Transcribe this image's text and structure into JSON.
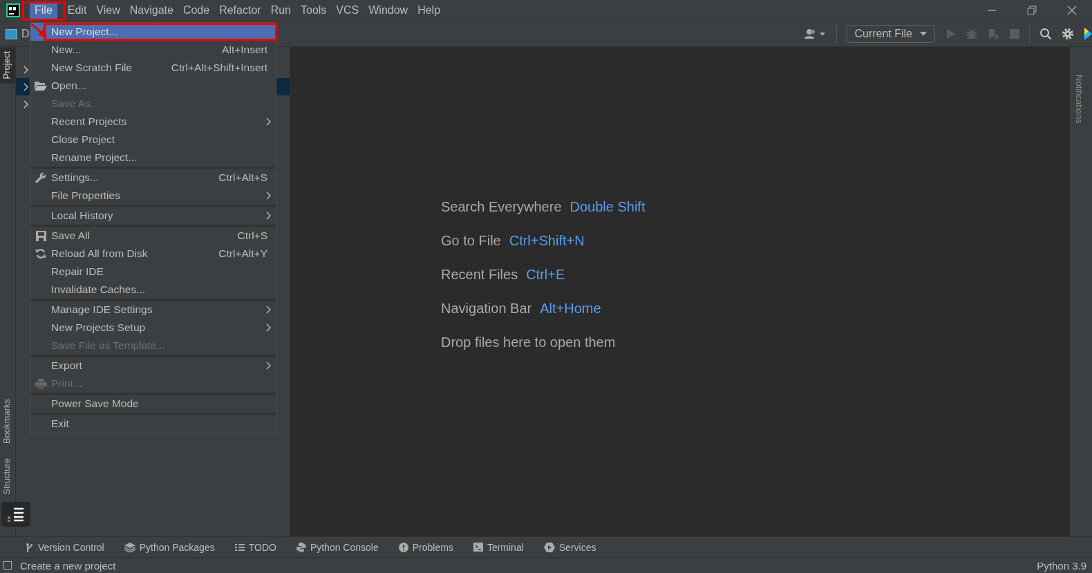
{
  "menubar": [
    {
      "label": "File",
      "selected": true
    },
    {
      "label": "Edit",
      "selected": false
    },
    {
      "label": "View",
      "selected": false
    },
    {
      "label": "Navigate",
      "selected": false
    },
    {
      "label": "Code",
      "selected": false
    },
    {
      "label": "Refactor",
      "selected": false
    },
    {
      "label": "Run",
      "selected": false
    },
    {
      "label": "Tools",
      "selected": false
    },
    {
      "label": "VCS",
      "selected": false
    },
    {
      "label": "Window",
      "selected": false
    },
    {
      "label": "Help",
      "selected": false
    }
  ],
  "toolbar": {
    "project_name": "D",
    "run_config": "Current File"
  },
  "left_stripe": [
    {
      "label": "Project",
      "selected": true
    },
    {
      "label": "Bookmarks",
      "selected": false
    },
    {
      "label": "Structure",
      "selected": false
    }
  ],
  "right_stripe": [
    {
      "label": "Notifications",
      "selected": false
    }
  ],
  "file_menu": {
    "sections": [
      [
        {
          "kind": "plain",
          "label": "New Project...",
          "submenu": false,
          "disabled": false,
          "selected": true
        },
        {
          "kind": "plain",
          "label": "New...",
          "shortcut": "Alt+Insert",
          "submenu": false,
          "disabled": false,
          "selected": false
        },
        {
          "kind": "plain",
          "label": "New Scratch File",
          "shortcut": "Ctrl+Alt+Shift+Insert",
          "submenu": false,
          "disabled": false,
          "selected": false
        },
        {
          "kind": "open",
          "label": "Open...",
          "submenu": false,
          "disabled": false,
          "selected": false
        },
        {
          "kind": "plain",
          "label": "Save As...",
          "submenu": false,
          "disabled": true,
          "selected": false
        },
        {
          "kind": "plain",
          "label": "Recent Projects",
          "submenu": true,
          "disabled": false,
          "selected": false
        },
        {
          "kind": "plain",
          "label": "Close Project",
          "submenu": false,
          "disabled": false,
          "selected": false
        },
        {
          "kind": "plain",
          "label": "Rename Project...",
          "submenu": false,
          "disabled": false,
          "selected": false
        }
      ],
      [
        {
          "kind": "settings",
          "label": "Settings...",
          "shortcut": "Ctrl+Alt+S",
          "submenu": false,
          "disabled": false,
          "selected": false
        },
        {
          "kind": "plain",
          "label": "File Properties",
          "submenu": true,
          "disabled": false,
          "selected": false
        }
      ],
      [
        {
          "kind": "plain",
          "label": "Local History",
          "submenu": true,
          "disabled": false,
          "selected": false
        }
      ],
      [
        {
          "kind": "save",
          "label": "Save All",
          "shortcut": "Ctrl+S",
          "submenu": false,
          "disabled": false,
          "selected": false
        },
        {
          "kind": "reload",
          "label": "Reload All from Disk",
          "shortcut": "Ctrl+Alt+Y",
          "submenu": false,
          "disabled": false,
          "selected": false
        },
        {
          "kind": "plain",
          "label": "Repair IDE",
          "submenu": false,
          "disabled": false,
          "selected": false
        },
        {
          "kind": "plain",
          "label": "Invalidate Caches...",
          "submenu": false,
          "disabled": false,
          "selected": false
        }
      ],
      [
        {
          "kind": "plain",
          "label": "Manage IDE Settings",
          "submenu": true,
          "disabled": false,
          "selected": false
        },
        {
          "kind": "plain",
          "label": "New Projects Setup",
          "submenu": true,
          "disabled": false,
          "selected": false
        },
        {
          "kind": "plain",
          "label": "Save File as Template...",
          "submenu": false,
          "disabled": true,
          "selected": false
        }
      ],
      [
        {
          "kind": "plain",
          "label": "Export",
          "submenu": true,
          "disabled": false,
          "selected": false
        },
        {
          "kind": "print",
          "label": "Print...",
          "submenu": false,
          "disabled": true,
          "selected": false
        }
      ],
      [
        {
          "kind": "plain",
          "label": "Power Save Mode",
          "submenu": false,
          "disabled": false,
          "selected": false
        }
      ],
      [
        {
          "kind": "plain",
          "label": "Exit",
          "submenu": false,
          "disabled": false,
          "selected": false
        }
      ]
    ]
  },
  "editor_hints": [
    {
      "label": "Search Everywhere",
      "shortcut": "Double Shift"
    },
    {
      "label": "Go to File",
      "shortcut": "Ctrl+Shift+N"
    },
    {
      "label": "Recent Files",
      "shortcut": "Ctrl+E"
    },
    {
      "label": "Navigation Bar",
      "shortcut": "Alt+Home"
    },
    {
      "label": "Drop files here to open them"
    }
  ],
  "tool_windows": [
    {
      "kind": "vcs",
      "label": "Version Control"
    },
    {
      "kind": "packages",
      "label": "Python Packages"
    },
    {
      "kind": "todo",
      "label": "TODO"
    },
    {
      "kind": "console",
      "label": "Python Console"
    },
    {
      "kind": "problems",
      "label": "Problems"
    },
    {
      "kind": "terminal",
      "label": "Terminal"
    },
    {
      "kind": "services",
      "label": "Services"
    }
  ],
  "status_bar": {
    "message": "Create a new project",
    "interpreter": "Python 3.9"
  }
}
